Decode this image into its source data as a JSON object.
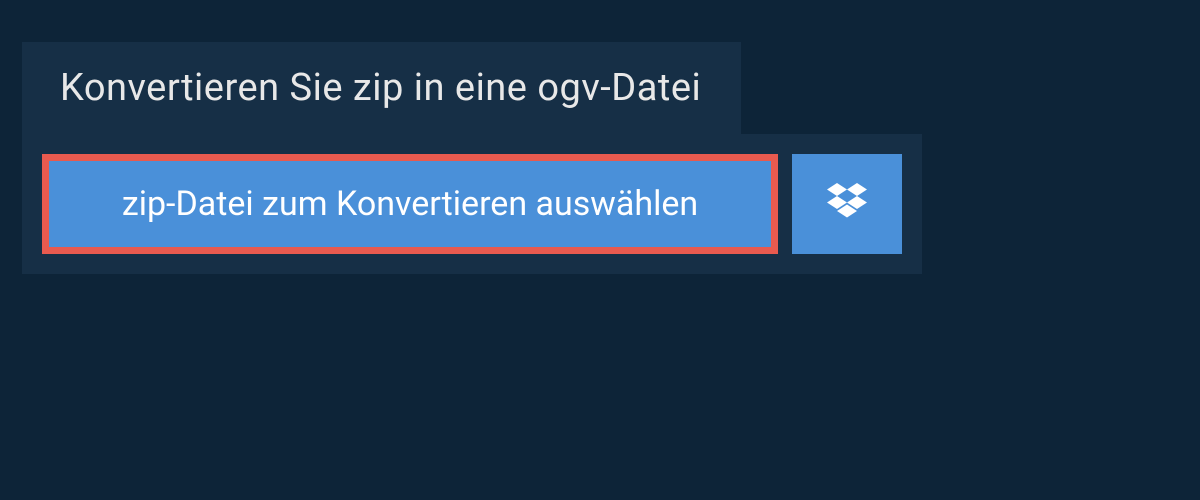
{
  "header": {
    "title": "Konvertieren Sie zip in eine ogv-Datei"
  },
  "upload": {
    "select_file_label": "zip-Datei zum Konvertieren auswählen"
  }
}
